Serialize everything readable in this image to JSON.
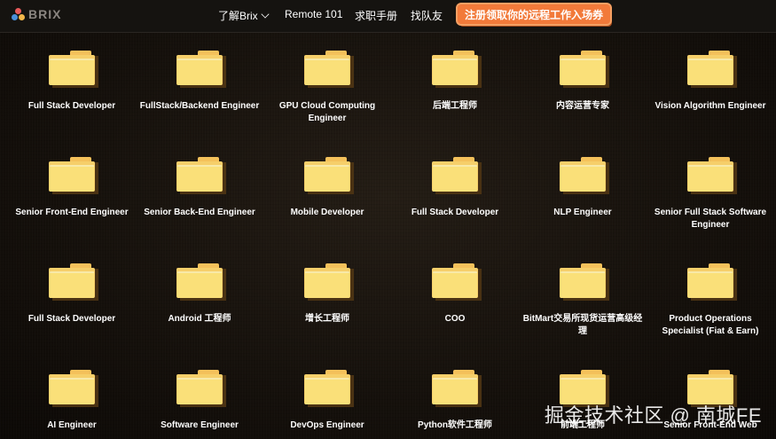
{
  "header": {
    "logo_text": "BRIX",
    "nav": [
      {
        "label": "了解Brix"
      },
      {
        "label": "Remote 101"
      },
      {
        "label": "求职手册"
      },
      {
        "label": "找队友"
      }
    ],
    "cta_label": "注册领取你的远程工作入场券"
  },
  "folders": [
    {
      "label": "Full Stack Developer"
    },
    {
      "label": "FullStack/Backend Engineer"
    },
    {
      "label": "GPU Cloud Computing Engineer"
    },
    {
      "label": "后端工程师"
    },
    {
      "label": "内容运营专家"
    },
    {
      "label": "Vision Algorithm Engineer"
    },
    {
      "label": "Senior Front-End Engineer"
    },
    {
      "label": "Senior Back-End Engineer"
    },
    {
      "label": "Mobile Developer"
    },
    {
      "label": "Full Stack Developer"
    },
    {
      "label": "NLP Engineer"
    },
    {
      "label": "Senior Full Stack Software Engineer"
    },
    {
      "label": "Full Stack Developer"
    },
    {
      "label": "Android 工程师"
    },
    {
      "label": "增长工程师"
    },
    {
      "label": "COO"
    },
    {
      "label": "BitMart交易所现货运营高级经理"
    },
    {
      "label": "Product Operations Specialist (Fiat & Earn)"
    },
    {
      "label": "AI Engineer"
    },
    {
      "label": "Software Engineer"
    },
    {
      "label": "DevOps Engineer"
    },
    {
      "label": "Python软件工程师"
    },
    {
      "label": "前端工程师"
    },
    {
      "label": "Senior Front-End Web"
    }
  ],
  "watermark": "掘金技术社区 @ 南城FE"
}
